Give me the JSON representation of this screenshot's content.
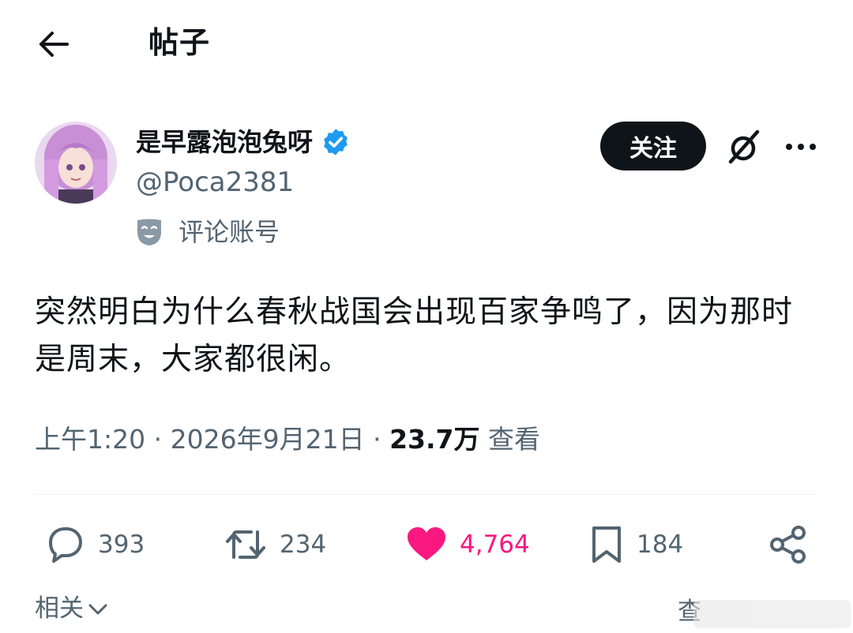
{
  "header": {
    "title": "帖子"
  },
  "author": {
    "display_name": "是早露泡泡兔呀",
    "handle": "@Poca2381",
    "label": "评论账号",
    "follow_label": "关注"
  },
  "post": {
    "text": "突然明白为什么春秋战国会出现百家争鸣了，因为那时是周末，大家都很闲。",
    "time": "上午1:20",
    "date": "2026年9月21日",
    "views": "23.7万",
    "views_suffix": "查看"
  },
  "actions": {
    "replies": "393",
    "reposts": "234",
    "likes": "4,764",
    "bookmarks": "184"
  },
  "footer": {
    "related_label": "相关",
    "corner_text": "查"
  },
  "colors": {
    "like": "#f91880",
    "verified": "#1d9bf0",
    "secondary_text": "#536471"
  }
}
